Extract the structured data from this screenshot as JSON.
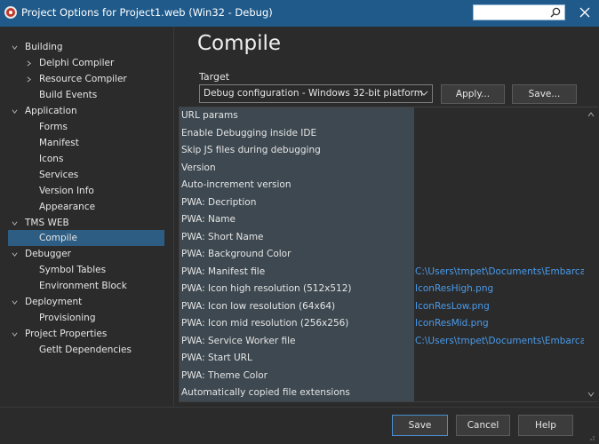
{
  "window": {
    "title": "Project Options for Project1.web  (Win32 - Debug)",
    "search_placeholder": "",
    "colors": {
      "titlebar": "#1f5a8a",
      "background": "#2b2b2b",
      "selection": "#2d5d82",
      "link": "#4a9bea"
    }
  },
  "tree": {
    "items": [
      {
        "label": "Building",
        "expanded": true
      },
      {
        "label": "Delphi Compiler",
        "expanded": false
      },
      {
        "label": "Resource Compiler",
        "expanded": false
      },
      {
        "label": "Build Events"
      },
      {
        "label": "Application",
        "expanded": true
      },
      {
        "label": "Forms"
      },
      {
        "label": "Manifest"
      },
      {
        "label": "Icons"
      },
      {
        "label": "Services"
      },
      {
        "label": "Version Info"
      },
      {
        "label": "Appearance"
      },
      {
        "label": "TMS WEB",
        "expanded": true
      },
      {
        "label": "Compile",
        "selected": true
      },
      {
        "label": "Debugger",
        "expanded": true
      },
      {
        "label": "Symbol Tables"
      },
      {
        "label": "Environment Block"
      },
      {
        "label": "Deployment",
        "expanded": true
      },
      {
        "label": "Provisioning"
      },
      {
        "label": "Project Properties",
        "expanded": true
      },
      {
        "label": "GetIt Dependencies"
      }
    ]
  },
  "main": {
    "title": "Compile",
    "target_label": "Target",
    "target_value": "Debug configuration - Windows 32-bit platform",
    "apply_label": "Apply...",
    "save_label": "Save..."
  },
  "grid": {
    "rows": [
      {
        "name": "URL params",
        "value": ""
      },
      {
        "name": "Enable Debugging inside IDE",
        "value": ""
      },
      {
        "name": "Skip JS files during debugging",
        "value": ""
      },
      {
        "name": "Version",
        "value": ""
      },
      {
        "name": "Auto-increment version",
        "value": ""
      },
      {
        "name": "PWA: Decription",
        "value": ""
      },
      {
        "name": "PWA: Name",
        "value": ""
      },
      {
        "name": "PWA: Short Name",
        "value": ""
      },
      {
        "name": "PWA: Background Color",
        "value": ""
      },
      {
        "name": "PWA: Manifest file",
        "value": "C:\\Users\\tmpet\\Documents\\Embarcaderc"
      },
      {
        "name": "PWA: Icon high resolution (512x512)",
        "value": "IconResHigh.png"
      },
      {
        "name": "PWA: Icon low resolution (64x64)",
        "value": "IconResLow.png"
      },
      {
        "name": "PWA: Icon mid resolution (256x256)",
        "value": "IconResMid.png"
      },
      {
        "name": "PWA: Service Worker file",
        "value": "C:\\Users\\tmpet\\Documents\\Embarcaderc"
      },
      {
        "name": "PWA: Start URL",
        "value": ""
      },
      {
        "name": "PWA: Theme Color",
        "value": ""
      },
      {
        "name": "Automatically copied file extensions",
        "value": ""
      }
    ]
  },
  "footer": {
    "save_label": "Save",
    "cancel_label": "Cancel",
    "help_label": "Help"
  }
}
